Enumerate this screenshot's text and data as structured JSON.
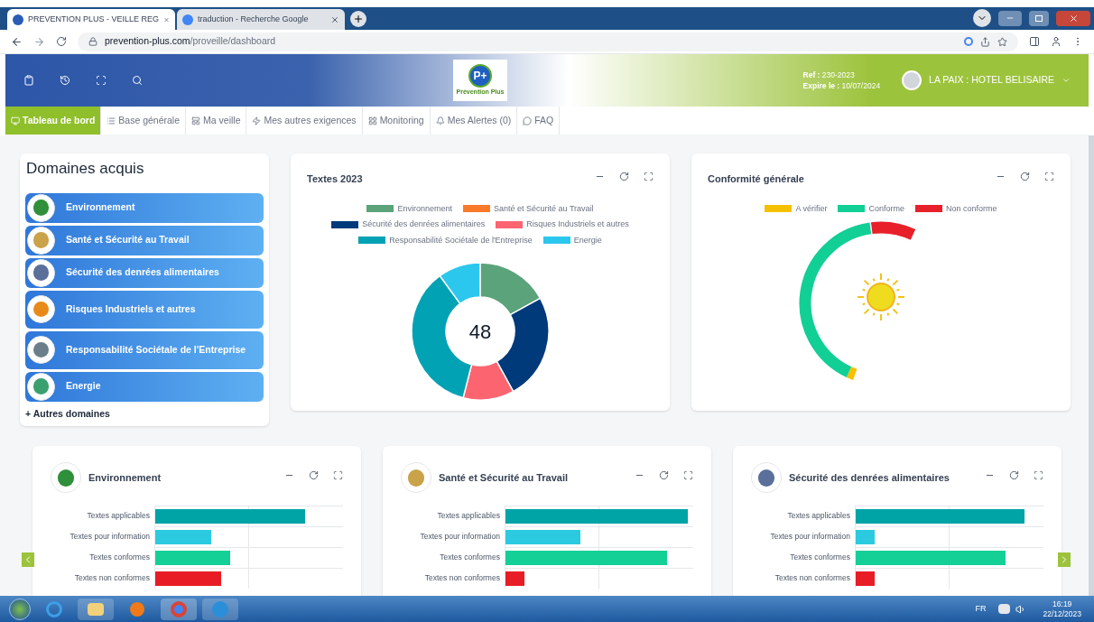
{
  "browser": {
    "tabs": [
      {
        "title": "PREVENTION PLUS - VEILLE REG",
        "selected": true
      },
      {
        "title": "traduction - Recherche Google",
        "selected": false
      }
    ],
    "url_host": "prevention-plus.com",
    "url_path": "/proveille/dashboard"
  },
  "header": {
    "logo_mark": "P+",
    "logo_text": "Prévention Plus",
    "ref_label": "Ref :",
    "ref": "230-2023",
    "expire_label": "Expire le :",
    "expire": "10/07/2024",
    "user": "LA PAIX : HOTEL BELISAIRE"
  },
  "nav": [
    {
      "label": "Tableau de bord",
      "selected": true
    },
    {
      "label": "Base générale",
      "selected": false
    },
    {
      "label": "Ma veille",
      "selected": false
    },
    {
      "label": "Mes autres exigences",
      "selected": false
    },
    {
      "label": "Monitoring",
      "selected": false
    },
    {
      "label": "Mes Alertes (0)",
      "selected": false
    },
    {
      "label": "FAQ",
      "selected": false
    }
  ],
  "domains": {
    "title": "Domaines acquis",
    "items": [
      "Environnement",
      "Santé et Sécurité au Travail",
      "Sécurité des denrées alimentaires",
      "Risques Industriels et autres",
      "Responsabilité Sociétale de l'Entreprise",
      "Energie"
    ],
    "more": "+ Autres domaines"
  },
  "texts_card": {
    "title": "Textes 2023",
    "total": "48",
    "legend": [
      {
        "label": "Environnement",
        "color": "#5ba37a"
      },
      {
        "label": "Santé et Sécurité au Travail",
        "color": "#f97b2a"
      },
      {
        "label": "Sécurité des denrées alimentaires",
        "color": "#003a7a"
      },
      {
        "label": "Risques Industriels et autres",
        "color": "#fc6470"
      },
      {
        "label": "Responsabilité Sociétale de l'Entreprise",
        "color": "#00a2b4"
      },
      {
        "label": "Energie",
        "color": "#2cc7ec"
      }
    ]
  },
  "conformity_card": {
    "title": "Conformité générale",
    "legend": [
      {
        "label": "A vérifier",
        "color": "#f5c000"
      },
      {
        "label": "Conforme",
        "color": "#12cf95"
      },
      {
        "label": "Non conforme",
        "color": "#e8202a"
      }
    ]
  },
  "domain_cards": [
    {
      "title": "Environnement",
      "rows": [
        "Textes applicables",
        "Textes pour information",
        "Textes conformes",
        "Textes non conformes"
      ]
    },
    {
      "title": "Santé et Sécurité au Travail",
      "rows": [
        "Textes applicables",
        "Textes pour information",
        "Textes conformes",
        "Textes non conformes"
      ]
    },
    {
      "title": "Sécurité des denrées alimentaires",
      "rows": [
        "Textes applicables",
        "Textes pour information",
        "Textes conformes",
        "Textes non conformes"
      ]
    }
  ],
  "taskbar": {
    "language": "FR",
    "time": "16:19",
    "date": "22/12/2023"
  }
}
